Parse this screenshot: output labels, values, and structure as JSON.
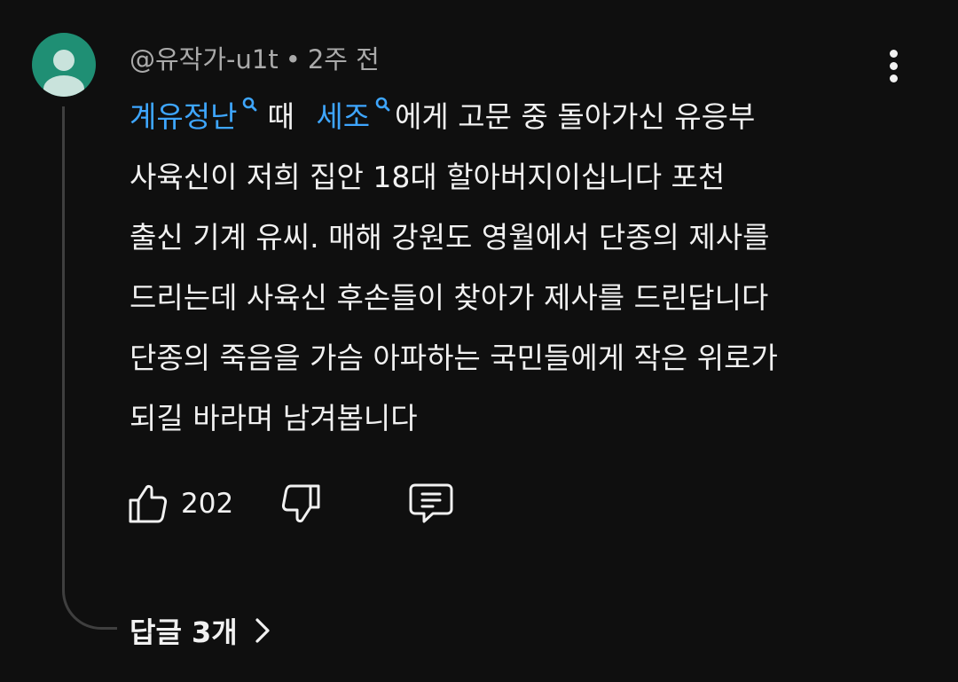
{
  "comment": {
    "author": "@유작가-u1t",
    "separator": "•",
    "time": "2주 전",
    "body": {
      "line1": {
        "link1": "계유정난",
        "text1": "때",
        "link2": "세조",
        "text2": "에게 고문 중  돌아가신 유응부"
      },
      "line2": "사육신이 저희 집안 18대 할아버지이십니다 포천",
      "line3": "출신 기계 유씨. 매해 강원도 영월에서 단종의 제사를",
      "line4": "드리는데 사육신 후손들이 찾아가 제사를 드린답니다",
      "line5": "단종의 죽음을 가슴 아파하는 국민들에게 작은 위로가",
      "line6": "되길 바라며 남겨봅니다"
    },
    "actions": {
      "like_count": "202",
      "like_icon": "thumb-up-icon",
      "dislike_icon": "thumb-down-icon",
      "reply_icon": "comment-icon",
      "menu_icon": "more-vert-icon"
    },
    "replies_label": "답글 3개",
    "colors": {
      "background": "#0f0f0f",
      "text": "#f1f1f1",
      "secondary_text": "#aaaaaa",
      "link": "#3ea6ff",
      "avatar": "#1f8f74",
      "thread_line": "#3f3f3f"
    }
  }
}
